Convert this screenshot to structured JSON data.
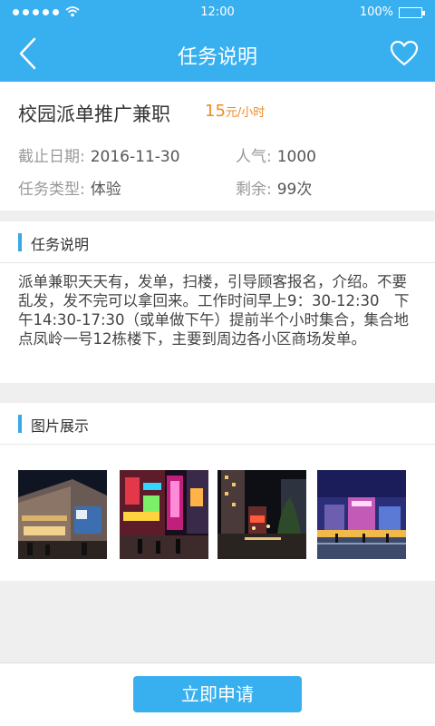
{
  "status_bar": {
    "time": "12:00",
    "battery": "100%"
  },
  "nav": {
    "title": "任务说明"
  },
  "job": {
    "title": "校园派单推广兼职",
    "salary_amount": "15",
    "salary_unit": "元/小时",
    "deadline_label": "截止日期:",
    "deadline": "2016-11-30",
    "popularity_label": "人气:",
    "popularity": "1000",
    "type_label": "任务类型:",
    "type": "体验",
    "remaining_label": "剩余:",
    "remaining": "99次"
  },
  "description": {
    "heading": "任务说明",
    "text": "派单兼职天天有，发单，扫楼，引导顾客报名，介绍。不要乱发，发不完可以拿回来。工作时间早上9：30-12:30　下午14:30-17:30（或单做下午）提前半个小时集合，集合地点凤岭一号12栋楼下，主要到周边各小区商场发单。"
  },
  "gallery": {
    "heading": "图片展示"
  },
  "actions": {
    "apply_label": "立即申请"
  },
  "colors": {
    "accent": "#38b0f0",
    "salary": "#f08a24"
  }
}
